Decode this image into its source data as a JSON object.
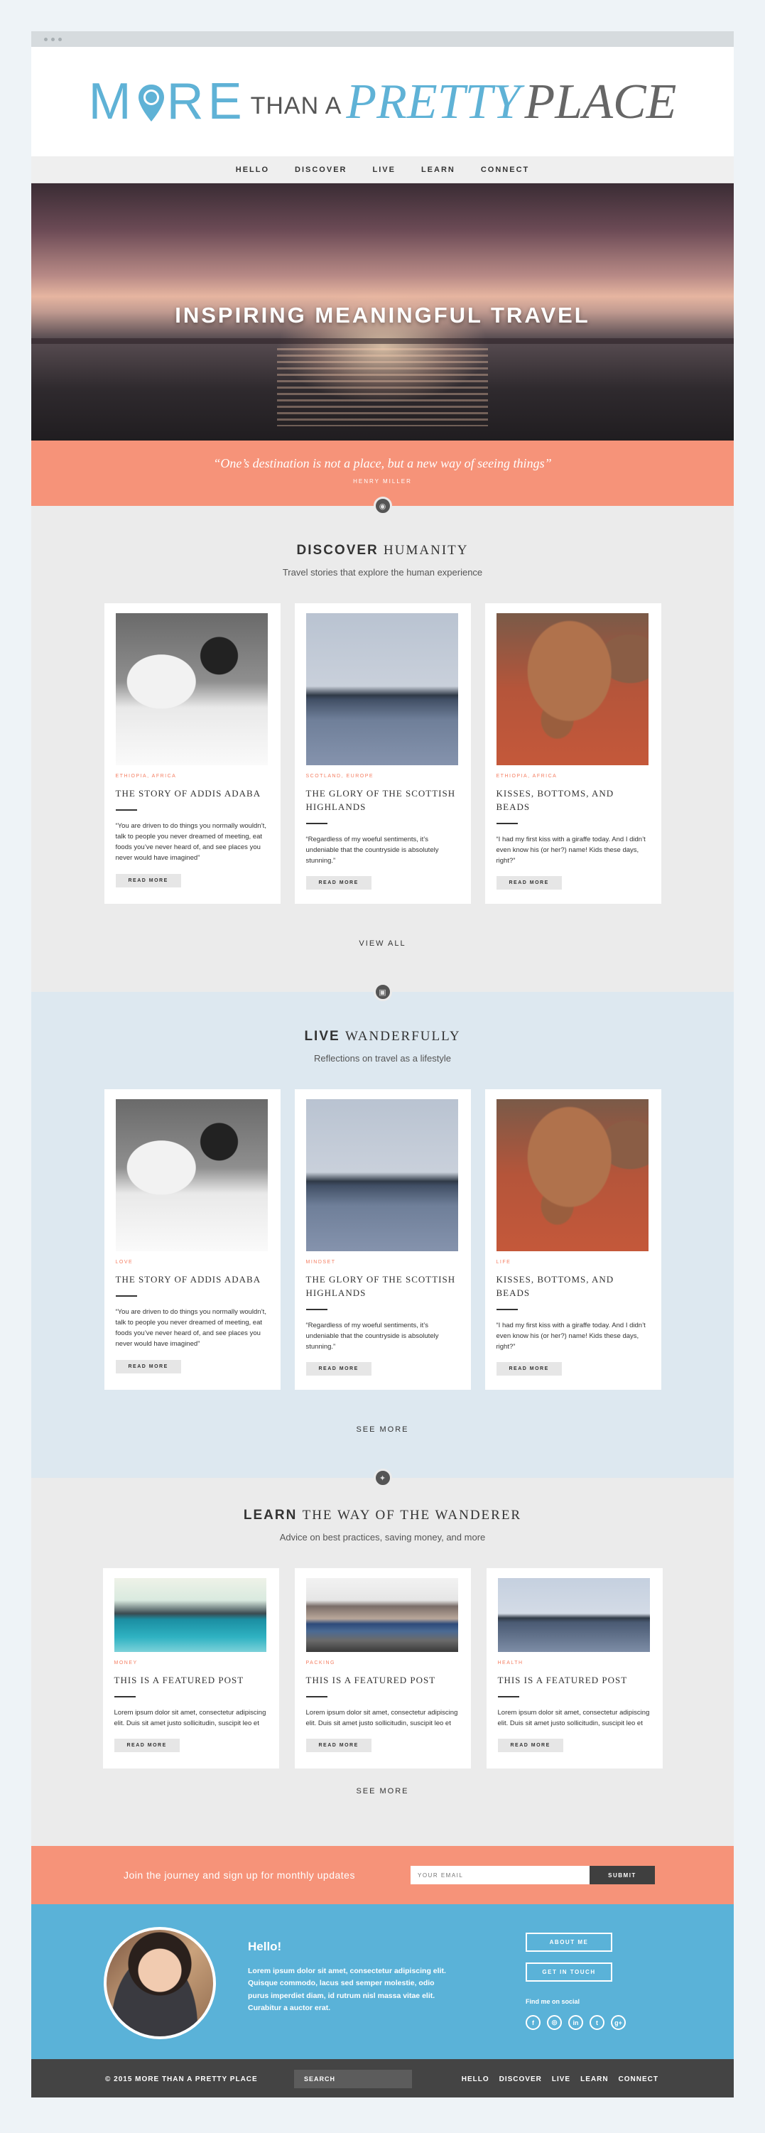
{
  "logo": {
    "more": "M",
    "ore": "RE",
    "than": "THAN A",
    "pretty": "PRETTY",
    "place": "PLACE"
  },
  "nav": [
    "HELLO",
    "DISCOVER",
    "LIVE",
    "LEARN",
    "CONNECT"
  ],
  "hero": {
    "title": "INSPIRING MEANINGFUL TRAVEL"
  },
  "quote": {
    "text": "“One’s destination is not a place, but a new way of seeing things”",
    "author": "HENRY MILLER"
  },
  "discover": {
    "title_bold": "DISCOVER",
    "title_rest": "HUMANITY",
    "subtitle": "Travel stories that explore the human experience",
    "cards": [
      {
        "category": "ETHIOPIA, AFRICA",
        "title": "THE STORY OF ADDIS ADABA",
        "excerpt": "“You are driven to do things you normally wouldn’t, talk to people you never dreamed of meeting, eat foods you’ve never heard of, and see places you never would have imagined”",
        "button": "READ MORE"
      },
      {
        "category": "SCOTLAND, EUROPE",
        "title": "THE GLORY OF THE SCOTTISH HIGHLANDS",
        "excerpt": "“Regardless of my woeful sentiments, it’s undeniable that the countryside is absolutely stunning.”",
        "button": "READ MORE"
      },
      {
        "category": "ETHIOPIA, AFRICA",
        "title": "KISSES, BOTTOMS, AND BEADS",
        "excerpt": "“I had my first kiss with a giraffe today. And I didn’t even know his (or her?) name! Kids these days, right?”",
        "button": "READ MORE"
      }
    ],
    "more": "VIEW ALL"
  },
  "live": {
    "title_bold": "LIVE",
    "title_rest": "WANDERFULLY",
    "subtitle": "Reflections on travel as a lifestyle",
    "cards": [
      {
        "category": "LOVE",
        "title": "THE STORY OF ADDIS ADABA",
        "excerpt": "“You are driven to do things you normally wouldn’t, talk to people you never dreamed of meeting, eat foods you’ve never heard of, and see places you never would have imagined”",
        "button": "READ MORE"
      },
      {
        "category": "MINDSET",
        "title": "THE GLORY OF THE SCOTTISH HIGHLANDS",
        "excerpt": "“Regardless of my woeful sentiments, it’s undeniable that the countryside is absolutely stunning.”",
        "button": "READ MORE"
      },
      {
        "category": "LIFE",
        "title": "KISSES, BOTTOMS, AND BEADS",
        "excerpt": "“I had my first kiss with a giraffe today. And I didn’t even know his (or her?) name! Kids these days, right?”",
        "button": "READ MORE"
      }
    ],
    "more": "SEE MORE"
  },
  "learn": {
    "title_bold": "LEARN",
    "title_rest": "THE WAY OF THE WANDERER",
    "subtitle": "Advice on best practices, saving money, and more",
    "cards": [
      {
        "category": "MONEY",
        "title": "THIS IS A FEATURED POST",
        "excerpt": "Lorem ipsum dolor sit amet, consectetur adipiscing elit. Duis sit amet justo sollicitudin, suscipit leo et",
        "button": "READ MORE"
      },
      {
        "category": "PACKING",
        "title": "THIS IS A FEATURED POST",
        "excerpt": "Lorem ipsum dolor sit amet, consectetur adipiscing elit. Duis sit amet justo sollicitudin, suscipit leo et",
        "button": "READ MORE"
      },
      {
        "category": "HEALTH",
        "title": "THIS IS A FEATURED POST",
        "excerpt": "Lorem ipsum dolor sit amet, consectetur adipiscing elit. Duis sit amet justo sollicitudin, suscipit leo et",
        "button": "READ MORE"
      }
    ],
    "more": "SEE MORE"
  },
  "signup": {
    "text": "Join the journey and sign up for monthly updates",
    "placeholder": "YOUR EMAIL",
    "button": "SUBMIT"
  },
  "about": {
    "heading": "Hello!",
    "body": "Lorem ipsum dolor sit amet, consectetur adipiscing elit. Quisque commodo, lacus sed semper molestie, odio purus imperdiet diam, id rutrum nisl massa vitae elit. Curabitur a auctor erat.",
    "about_button": "ABOUT ME",
    "contact_button": "GET IN TOUCH",
    "social_label": "Find me on social",
    "social_icons": [
      "facebook-icon",
      "instagram-icon",
      "linkedin-icon",
      "twitter-icon",
      "google-plus-icon"
    ]
  },
  "footer": {
    "copyright": "© 2015 MORE THAN A PRETTY PLACE",
    "search": "SEARCH",
    "links": [
      "HELLO",
      "DISCOVER",
      "LIVE",
      "LEARN",
      "CONNECT"
    ]
  },
  "colors": {
    "coral": "#f69379",
    "blue": "#5ab2d8",
    "dark": "#444444"
  }
}
